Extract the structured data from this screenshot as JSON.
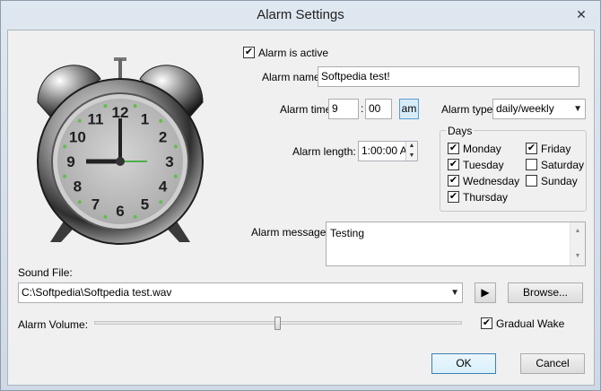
{
  "window": {
    "title": "Alarm Settings",
    "close_glyph": "✕"
  },
  "alarm_active": {
    "label": "Alarm is active",
    "checked": true
  },
  "alarm_name": {
    "label": "Alarm name:",
    "value": "Softpedia test!"
  },
  "alarm_time": {
    "label": "Alarm time:",
    "hour": "9",
    "separator": ":",
    "minute": "00",
    "ampm": "am"
  },
  "alarm_type": {
    "label": "Alarm type:",
    "value": "daily/weekly"
  },
  "alarm_length": {
    "label": "Alarm length:",
    "value": "1:00:00 A"
  },
  "days": {
    "title": "Days",
    "items": [
      {
        "label": "Monday",
        "checked": true
      },
      {
        "label": "Tuesday",
        "checked": true
      },
      {
        "label": "Wednesday",
        "checked": true
      },
      {
        "label": "Thursday",
        "checked": true
      },
      {
        "label": "Friday",
        "checked": true
      },
      {
        "label": "Saturday",
        "checked": false
      },
      {
        "label": "Sunday",
        "checked": false
      }
    ]
  },
  "alarm_message": {
    "label": "Alarm message:",
    "value": "Testing"
  },
  "sound_file": {
    "label": "Sound File:",
    "value": "C:\\Softpedia\\Softpedia test.wav",
    "play_glyph": "▶",
    "browse_label": "Browse..."
  },
  "volume": {
    "label": "Alarm Volume:",
    "level_percent": 50
  },
  "gradual_wake": {
    "label": "Gradual Wake",
    "checked": true
  },
  "buttons": {
    "ok": "OK",
    "cancel": "Cancel"
  },
  "clock": {
    "numerals": [
      "12",
      "1",
      "2",
      "3",
      "4",
      "5",
      "6",
      "7",
      "8",
      "9",
      "10",
      "11"
    ]
  },
  "check_glyph": "✔"
}
